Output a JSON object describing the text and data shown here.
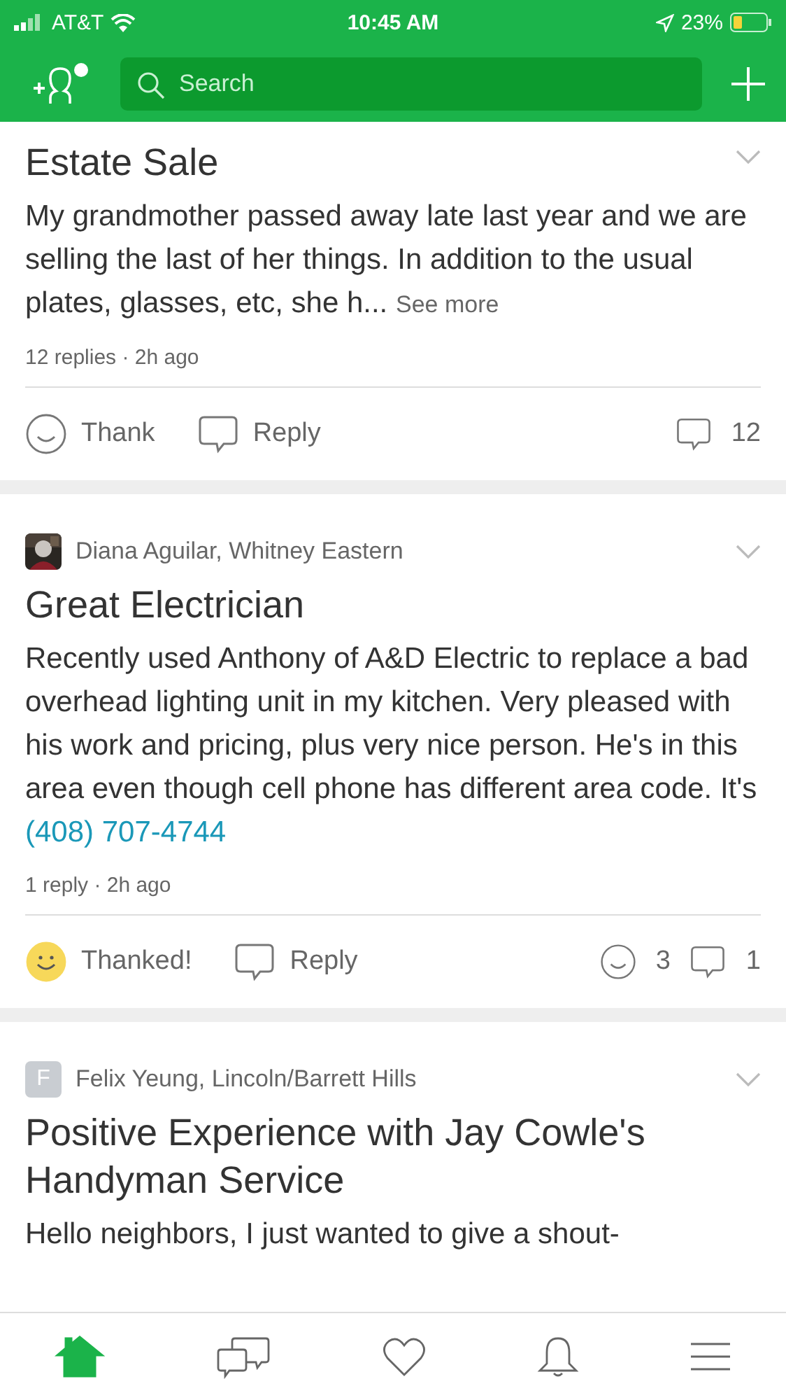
{
  "status_bar": {
    "carrier": "AT&T",
    "time": "10:45 AM",
    "battery": "23%"
  },
  "header": {
    "search": {
      "placeholder": "Search"
    }
  },
  "posts": [
    {
      "title": "Estate Sale",
      "body": "My grandmother passed away late last year and we are selling the last of her things. In addition to the usual plates, glasses, etc, she h...",
      "see_more": "See more",
      "meta": "12 replies · 2h ago",
      "thank": {
        "label": "Thank",
        "thanked": false
      },
      "reply": "Reply",
      "reply_count": "12"
    },
    {
      "author": "Diana Aguilar, Whitney Eastern",
      "title": "Great Electrician",
      "body": "Recently used Anthony of A&D Electric to replace a bad overhead lighting unit in my kitchen. Very pleased with his work and pricing, plus very nice person. He's in this area even though cell phone has different area code.  It's",
      "phone": "(408) 707-4744",
      "meta": "1 reply · 2h ago",
      "thank": {
        "label": "Thanked!",
        "thanked": true
      },
      "reply": "Reply",
      "thanks_count": "3",
      "reply_count": "1"
    },
    {
      "author": "Felix Yeung, Lincoln/Barrett Hills",
      "avatar": {
        "kind": "letter",
        "letter": "F"
      },
      "title": "Positive Experience with Jay Cowle's Handyman Service",
      "body": "Hello neighbors, I just wanted to give a shout-"
    }
  ],
  "tabs": [
    {
      "kind": "home",
      "selected": true
    },
    {
      "kind": "messages",
      "selected": false
    },
    {
      "kind": "favorites",
      "selected": false
    },
    {
      "kind": "notifications",
      "selected": false
    },
    {
      "kind": "menu",
      "selected": false
    }
  ]
}
